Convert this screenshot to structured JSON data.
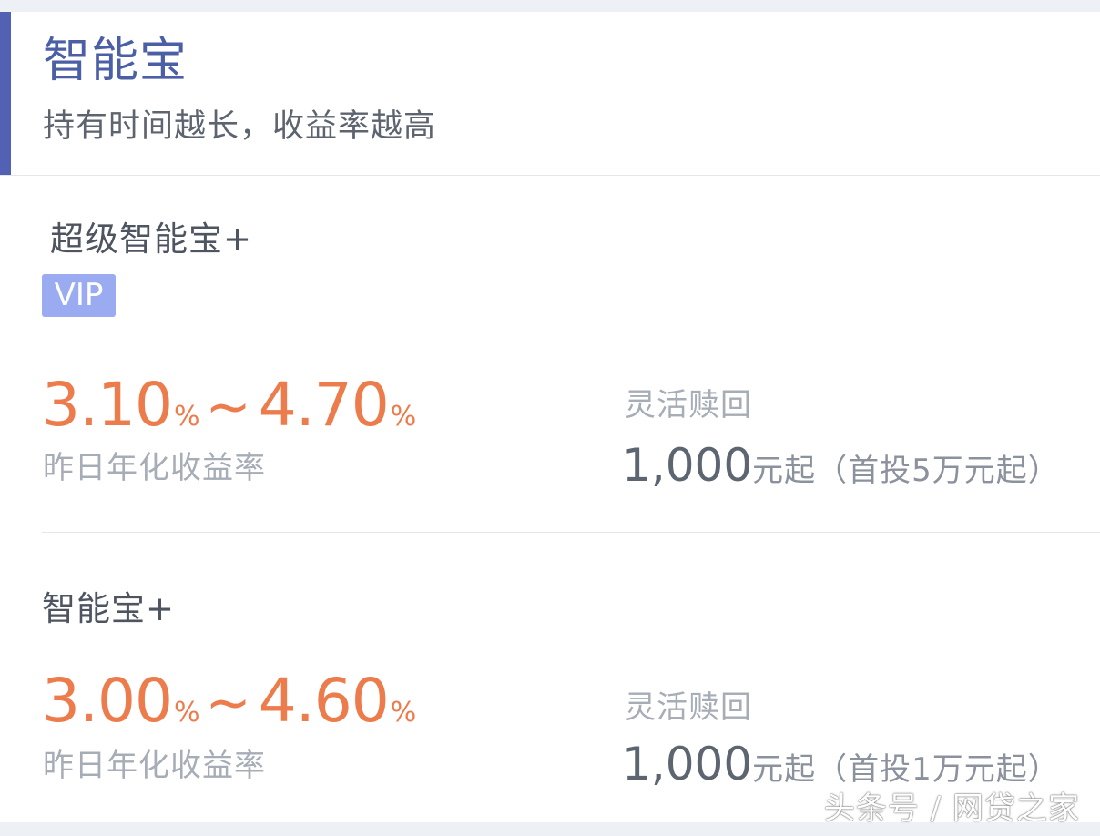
{
  "section": {
    "title": "智能宝",
    "subtitle": "持有时间越长，收益率越高"
  },
  "products": [
    {
      "name": "超级智能宝+",
      "badge": "VIP",
      "rate_min": "3.10",
      "rate_max": "4.70",
      "percent_sign": "%",
      "tilde": "~",
      "rate_label": "昨日年化收益率",
      "redeem_label": "灵活赎回",
      "min_amount": "1,000",
      "min_suffix": "元起（首投5万元起）"
    },
    {
      "name": "智能宝+",
      "rate_min": "3.00",
      "rate_max": "4.60",
      "percent_sign": "%",
      "tilde": "~",
      "rate_label": "昨日年化收益率",
      "redeem_label": "灵活赎回",
      "min_amount": "1,000",
      "min_suffix": "元起（首投1万元起）"
    }
  ],
  "watermark": "头条号 / 网贷之家",
  "colors": {
    "accent": "#5361b5",
    "title": "#4b5fa6",
    "rate": "#ec7c4c",
    "vip_badge": "#9aabf1"
  }
}
